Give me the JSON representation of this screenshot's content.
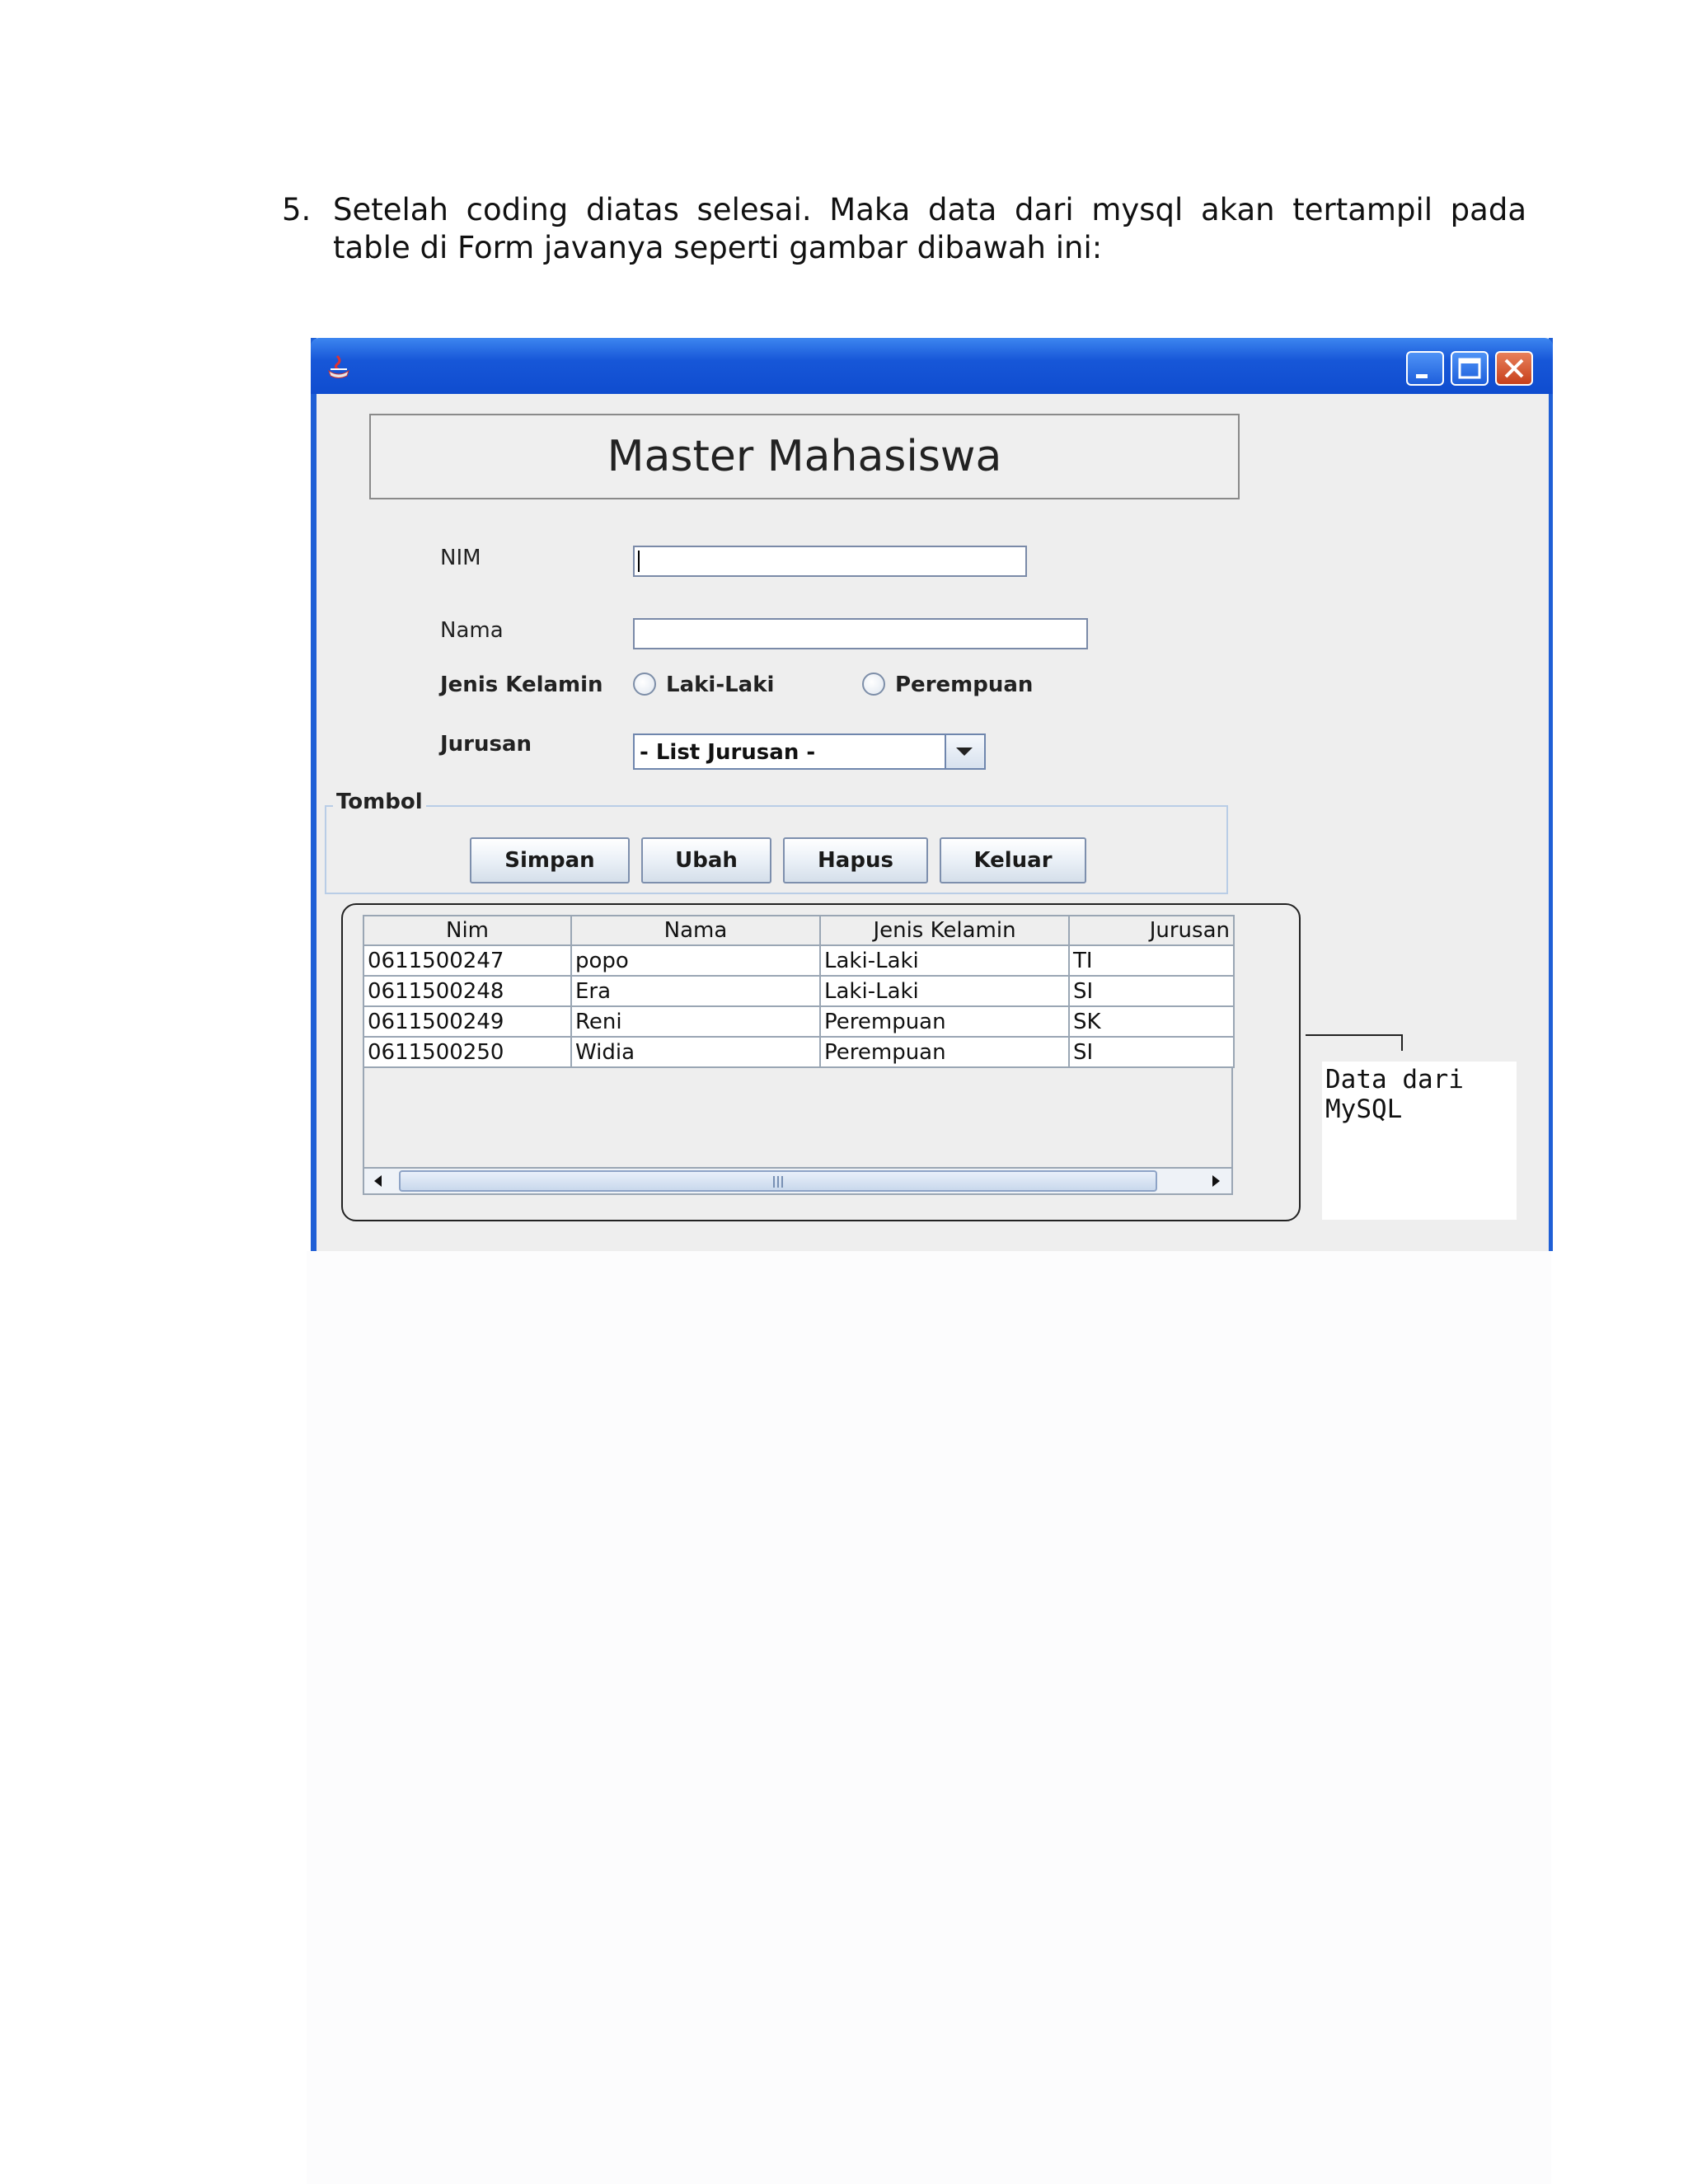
{
  "document": {
    "item_number": "5.",
    "paragraph": "Setelah coding diatas selesai. Maka data dari mysql akan tertampil pada table di Form javanya seperti gambar dibawah ini:"
  },
  "window": {
    "header_title": "Master Mahasiswa",
    "form": {
      "nim_label": "NIM",
      "nim_value": "",
      "nama_label": "Nama",
      "nama_value": "",
      "gender_label": "Jenis Kelamin",
      "gender_options": [
        "Laki-Laki",
        "Perempuan"
      ],
      "jurusan_label": "Jurusan",
      "jurusan_selected": "- List Jurusan -"
    },
    "buttons_group": {
      "title": "Tombol",
      "buttons": [
        "Simpan",
        "Ubah",
        "Hapus",
        "Keluar"
      ]
    },
    "table": {
      "columns": [
        "Nim",
        "Nama",
        "Jenis Kelamin",
        "Jurusan"
      ],
      "rows": [
        [
          "0611500247",
          "popo",
          "Laki-Laki",
          "TI"
        ],
        [
          "0611500248",
          "Era",
          "Laki-Laki",
          "SI"
        ],
        [
          "0611500249",
          "Reni",
          "Perempuan",
          "SK"
        ],
        [
          "0611500250",
          "Widia",
          "Perempuan",
          "SI"
        ]
      ]
    },
    "callout": "Data dari MySQL"
  },
  "colors": {
    "titlebar": "#1757d8",
    "close_button": "#c7401c"
  }
}
